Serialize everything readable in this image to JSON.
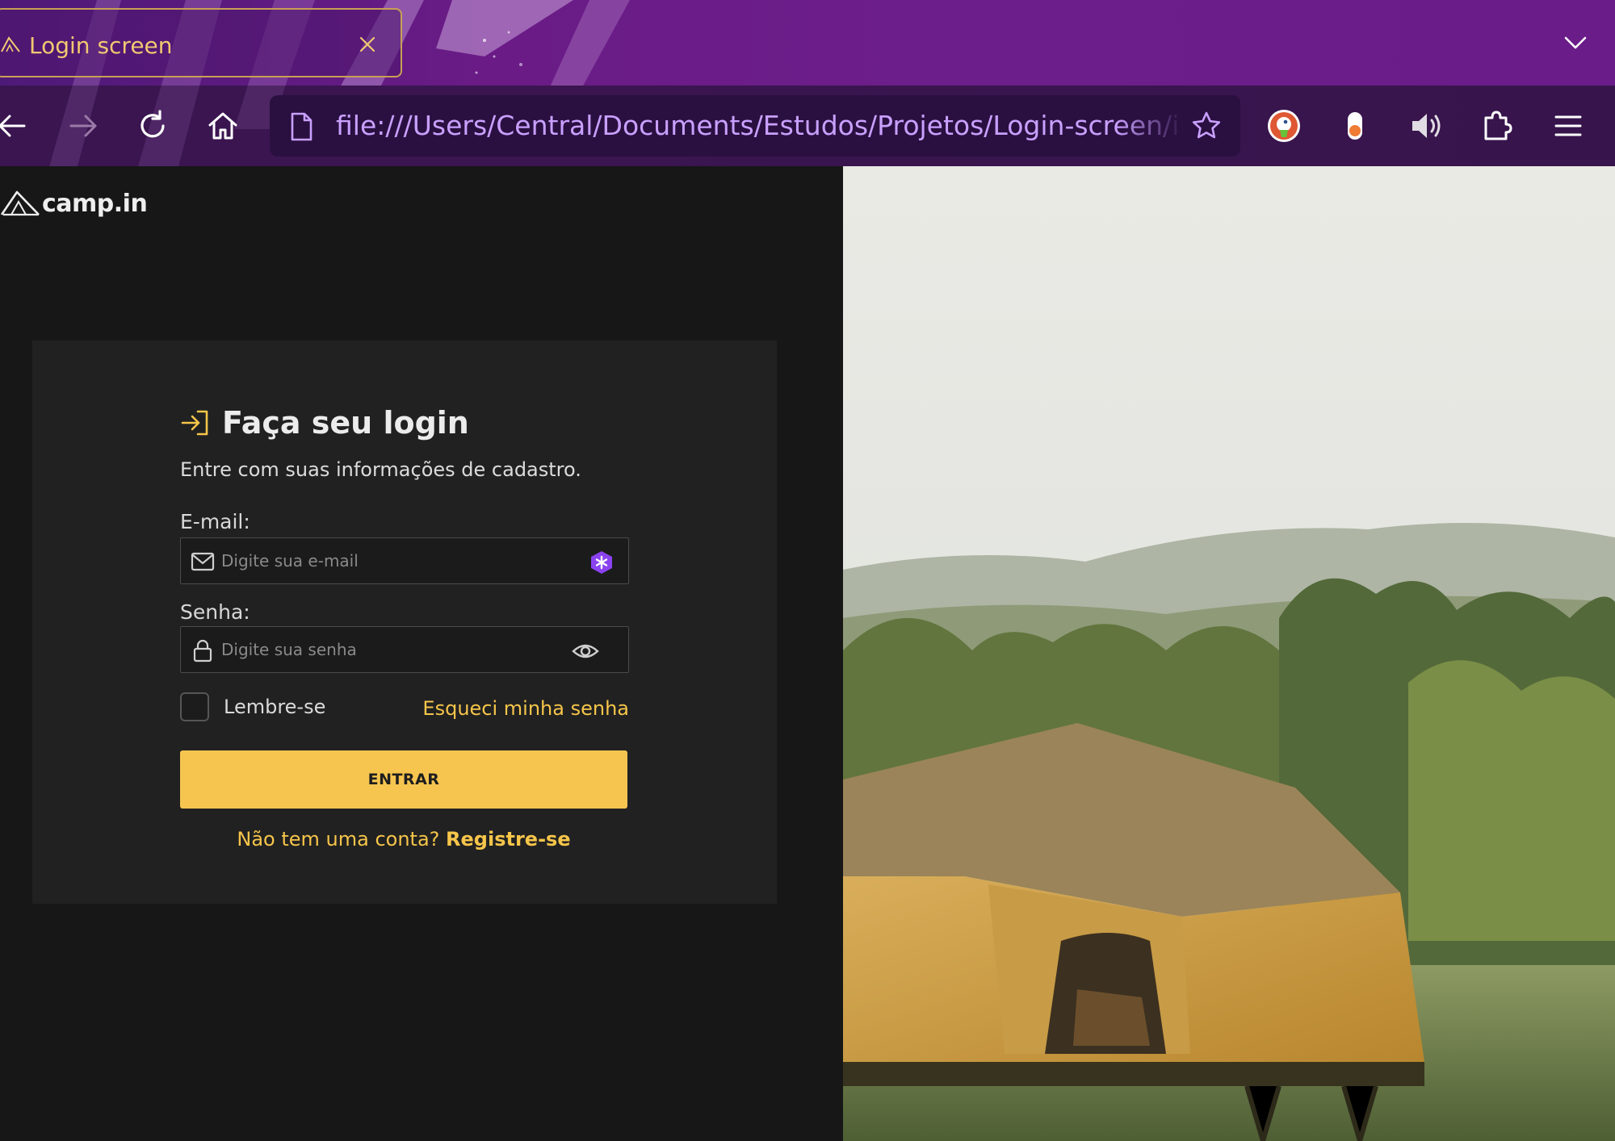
{
  "browser": {
    "tab": {
      "title": "Login screen",
      "favicon": "tent-icon",
      "close_icon": "close-icon"
    },
    "list_all_tabs_icon": "chevron-down-icon",
    "toolbar": {
      "back_icon": "arrow-left-icon",
      "forward_icon": "arrow-right-icon",
      "reload_icon": "reload-icon",
      "home_icon": "home-icon",
      "url_page_icon": "page-icon",
      "url": "file:///Users/Central/Documents/Estudos/Projetos/Login-screen/index.html",
      "bookmark_icon": "star-icon",
      "extensions": [
        "duckduckgo-icon",
        "toggle-extension-icon",
        "speaker-icon",
        "puzzle-icon"
      ],
      "menu_icon": "hamburger-menu-icon"
    },
    "colors": {
      "tabbar": "#6a1b86",
      "navbar": "#3a1550",
      "urlbar": "#2a1040",
      "url_text": "#c9a0ff",
      "tab_text": "#f1c871"
    }
  },
  "page": {
    "logo": {
      "icon": "tent-logo-icon",
      "text": "camp.in"
    },
    "login": {
      "icon": "sign-in-icon",
      "heading": "Faça seu login",
      "subtitle": "Entre com suas informações de cadastro.",
      "email": {
        "label": "E-mail:",
        "placeholder": "Digite sua e-mail",
        "value": "",
        "icon": "mail-icon",
        "extension_icon": "password-manager-icon"
      },
      "password": {
        "label": "Senha:",
        "placeholder": "Digite sua senha",
        "value": "",
        "icon": "lock-icon",
        "toggle_icon": "eye-icon"
      },
      "remember": {
        "label": "Lembre-se",
        "checked": false
      },
      "forgot_link": "Esqueci minha senha",
      "submit_label": "ENTRAR",
      "signup_prompt": "Não tem uma conta?",
      "signup_link": "Registre-se"
    },
    "hero_image": "camping-tent-lake-photo",
    "colors": {
      "accent": "#f6c54f",
      "background": "#171717",
      "card": "#212121"
    }
  }
}
